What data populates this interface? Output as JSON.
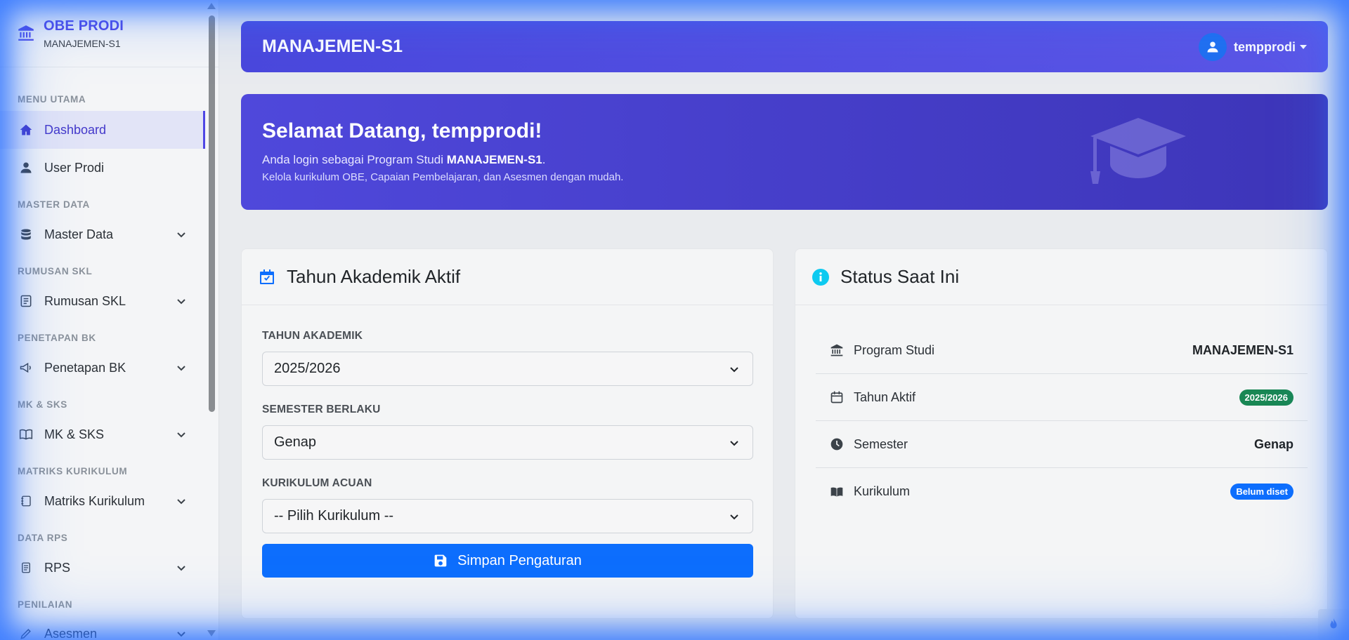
{
  "sidebar": {
    "brand_title": "OBE PRODI",
    "brand_sub": "MANAJEMEN-S1",
    "sections": {
      "menu_utama": "MENU UTAMA",
      "master_data": "MASTER DATA",
      "rumusan_skl": "RUMUSAN SKL",
      "penetapan_bk": "PENETAPAN BK",
      "mk_sks": "MK & SKS",
      "matriks": "MATRIKS KURIKULUM",
      "data_rps": "DATA RPS",
      "penilaian": "PENILAIAN"
    },
    "items": {
      "dashboard": "Dashboard",
      "user_prodi": "User Prodi",
      "master_data": "Master Data",
      "rumusan_skl": "Rumusan SKL",
      "penetapan_bk": "Penetapan BK",
      "mk_sks": "MK & SKS",
      "matriks": "Matriks Kurikulum",
      "rps": "RPS",
      "asesmen": "Asesmen"
    }
  },
  "header": {
    "title": "MANAJEMEN-S1",
    "username": "tempprodi"
  },
  "banner": {
    "title": "Selamat Datang, tempprodi!",
    "line1_prefix": "Anda login sebagai Program Studi ",
    "line1_bold": "MANAJEMEN-S1",
    "line1_suffix": ".",
    "line2": "Kelola kurikulum OBE, Capaian Pembelajaran, dan Asesmen dengan mudah."
  },
  "tahun_card": {
    "title": "Tahun Akademik Aktif",
    "tahun_label": "TAHUN AKADEMIK",
    "tahun_value": "2025/2026",
    "semester_label": "SEMESTER BERLAKU",
    "semester_value": "Genap",
    "kurikulum_label": "KURIKULUM ACUAN",
    "kurikulum_value": "-- Pilih Kurikulum --",
    "save_label": "Simpan Pengaturan"
  },
  "status_card": {
    "title": "Status Saat Ini",
    "rows": {
      "prodi_label": "Program Studi",
      "prodi_value": "MANAJEMEN-S1",
      "tahun_label": "Tahun Aktif",
      "tahun_value": "2025/2026",
      "semester_label": "Semester",
      "semester_value": "Genap",
      "kurikulum_label": "Kurikulum",
      "kurikulum_value": "Belum diset"
    }
  },
  "colors": {
    "accent": "#4f46e5",
    "primary_button": "#0d6efd",
    "success_badge": "#198754",
    "info_icon": "#0dcaf0"
  }
}
